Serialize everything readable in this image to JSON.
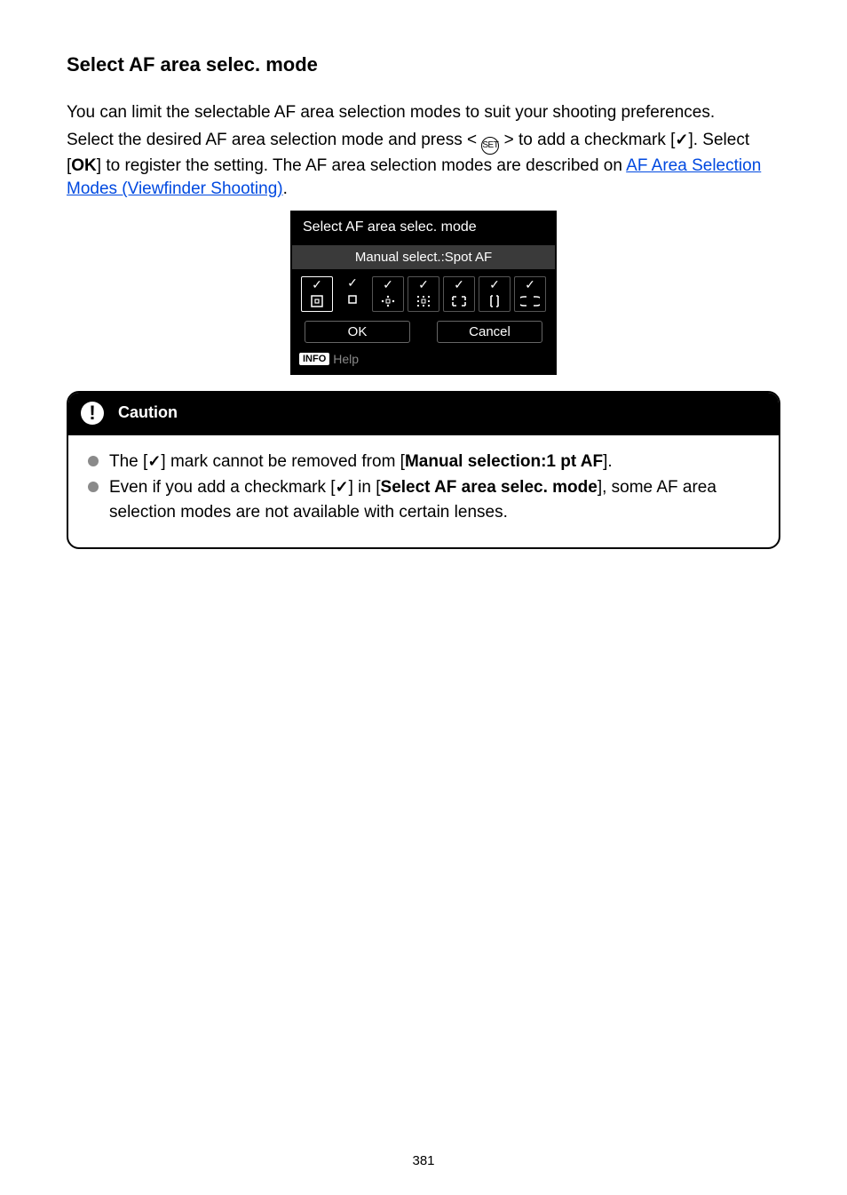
{
  "heading": "Select AF area selec. mode",
  "para1": "You can limit the selectable AF area selection modes to suit your shooting preferences.",
  "para2_a": "Select the desired AF area selection mode and press < ",
  "para2_b": " > to add a checkmark [",
  "para2_c": "]. Select [",
  "para2_ok": "OK",
  "para2_d": "] to register the setting. The AF area selection modes are described on ",
  "link_text": "AF Area Selection Modes (Viewfinder Shooting)",
  "para2_end": ".",
  "set_label": "SET",
  "check_glyph": "✓",
  "lcd": {
    "title": "Select AF area selec. mode",
    "subtitle": "Manual select.:Spot AF",
    "ok": "OK",
    "cancel": "Cancel",
    "info": "INFO",
    "help": "Help"
  },
  "caution": {
    "title": "Caution",
    "icon": "!",
    "item1_a": "The [",
    "item1_b": "] mark cannot be removed from [",
    "item1_bold": "Manual selection:1 pt AF",
    "item1_c": "].",
    "item2_a": "Even if you add a checkmark [",
    "item2_b": "] in [",
    "item2_bold": "Select AF area selec. mode",
    "item2_c": "], some AF area selection modes are not available with certain lenses."
  },
  "page_number": "381"
}
